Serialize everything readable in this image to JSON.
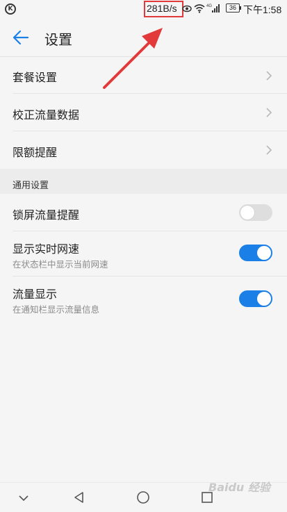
{
  "status_bar": {
    "left_icon": "K",
    "net_speed": "281B/s",
    "battery": "36",
    "time": "下午1:58",
    "icons": [
      "eye-icon",
      "wifi-icon",
      "signal-4g-icon",
      "battery-icon"
    ]
  },
  "header": {
    "back_icon": "arrow-left-icon",
    "title": "设置"
  },
  "menu": {
    "items": [
      {
        "label": "套餐设置"
      },
      {
        "label": "校正流量数据"
      },
      {
        "label": "限额提醒"
      }
    ]
  },
  "general": {
    "header": "通用设置",
    "items": [
      {
        "label": "锁屏流量提醒",
        "subtitle": "",
        "enabled": false
      },
      {
        "label": "显示实时网速",
        "subtitle": "在状态栏中显示当前网速",
        "enabled": true
      },
      {
        "label": "流量显示",
        "subtitle": "在通知栏显示流量信息",
        "enabled": true
      }
    ]
  },
  "navbar": {
    "items": [
      "chevron-down-icon",
      "back-triangle-icon",
      "home-circle-icon",
      "recents-square-icon"
    ]
  },
  "watermark": "Baidu 经验",
  "colors": {
    "accent": "#1a7fe6",
    "annotation_red": "#e23a3a",
    "background": "#f5f5f5"
  }
}
